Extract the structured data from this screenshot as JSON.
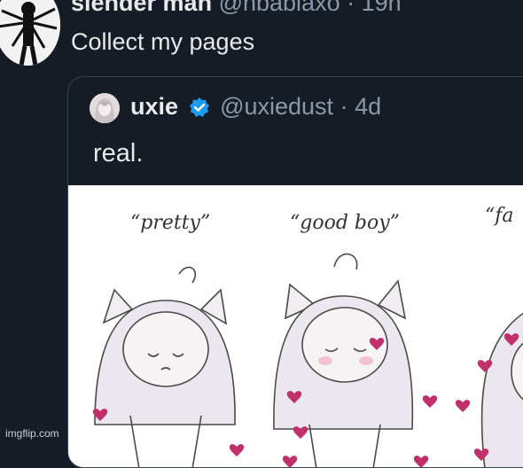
{
  "outer_tweet": {
    "name": "slender man",
    "handle": "@nbablaxo",
    "separator": "·",
    "time": "19h",
    "text": "Collect my pages",
    "avatar_icon": "slender-man-avatar-icon"
  },
  "quoted_tweet": {
    "name": "uxie",
    "handle": "@uxiedust",
    "separator": "·",
    "time": "4d",
    "text": "real.",
    "verified_color": "#1d9bf0",
    "avatar_icon": "anime-avatar-icon"
  },
  "image": {
    "captions": [
      "“pretty”",
      "“good boy”",
      "“fa"
    ],
    "heart_color": "#c0306a"
  },
  "watermark": "imgflip.com",
  "colors": {
    "background": "#151c26",
    "text_primary": "#e7e9ea",
    "text_secondary": "#8b98a5",
    "border": "#38444d"
  }
}
